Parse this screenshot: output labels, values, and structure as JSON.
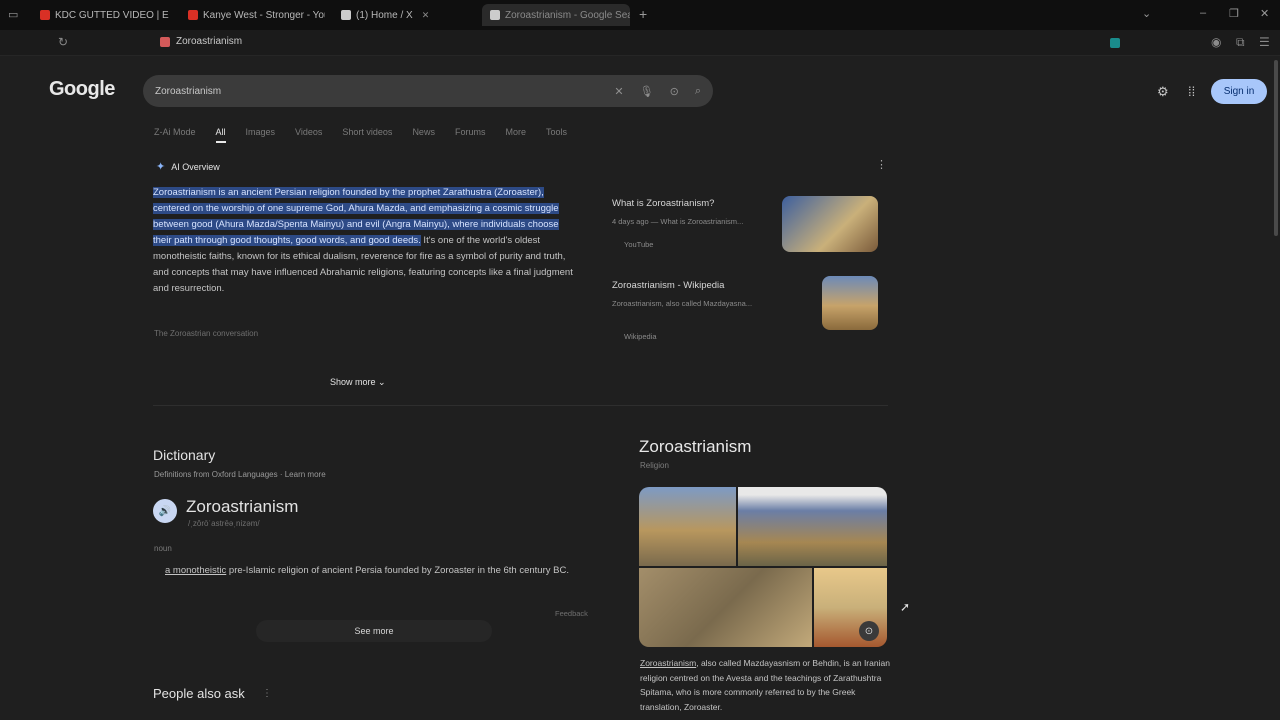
{
  "browser": {
    "tabs": [
      {
        "label": "KDC GUTTED VIDEO | E",
        "favicon_color": "#d93025",
        "active": false
      },
      {
        "label": "Kanye West - Stronger - YouTube",
        "favicon_color": "#d93025",
        "active": false
      },
      {
        "label": "(1) Home / X",
        "favicon_color": "#cccccc",
        "active": false
      },
      {
        "label": "Zoroastrianism - Google Search",
        "favicon_color": "#cccccc",
        "active": true
      }
    ],
    "new_tab": "+",
    "address_title": "Zoroastrianism"
  },
  "header": {
    "logo": "Google",
    "search_value": "Zoroastrianism",
    "signin_label": "Sign in"
  },
  "filters": [
    "Z-Ai Mode",
    "All",
    "Images",
    "Videos",
    "Short videos",
    "News",
    "Forums",
    "More",
    "Tools"
  ],
  "ai_overview": {
    "heading": "AI Overview",
    "highlighted": "Zoroastrianism is an ancient Persian religion founded by the prophet Zarathustra (Zoroaster), centered on the worship of one supreme God, Ahura Mazda, and emphasizing a cosmic struggle between good (Ahura Mazda/Spenta Mainyu) and evil (Angra Mainyu), where individuals choose their path through good thoughts, good words, and good deeds.",
    "rest": " It's one of the world's oldest monotheistic faiths, known for its ethical dualism, reverence for fire as a symbol of purity and truth, and concepts that may have influenced Abrahamic religions, featuring concepts like a final judgment and resurrection.",
    "note": "The Zoroastrian conversation",
    "show_more": "Show more",
    "sources": [
      {
        "title": "What is Zoroastrianism?",
        "snippet": "4 days ago — What is Zoroastrianism...",
        "meta": "YouTube"
      },
      {
        "title": "Zoroastrianism - Wikipedia",
        "snippet": "Zoroastrianism, also called Mazdayasna...",
        "meta": "Wikipedia"
      }
    ]
  },
  "dictionary": {
    "heading": "Dictionary",
    "source": "Definitions from Oxford Languages · Learn more",
    "word": "Zoroastrianism",
    "pronunciation": "/ˌzôrōˈastrēəˌnizəm/",
    "pos": "noun",
    "definition_link": "a monotheistic",
    "definition_rest": " pre-Islamic religion of ancient Persia founded by Zoroaster in the 6th century BC.",
    "feedback": "Feedback",
    "see_more": "See more"
  },
  "people_also_ask": "People also ask",
  "knowledge_panel": {
    "title": "Zoroastrianism",
    "subtitle": "Religion",
    "desc_link": "Zoroastrianism",
    "description": ", also called Mazdayasnism or Behdin, is an Iranian religion centred on the Avesta and the teachings of Zarathushtra Spitama, who is more commonly referred to by the Greek translation, Zoroaster.",
    "images_colors": [
      "#8a7a58",
      "#6b6448",
      "#7a6a4d",
      "#c9b07a"
    ]
  }
}
